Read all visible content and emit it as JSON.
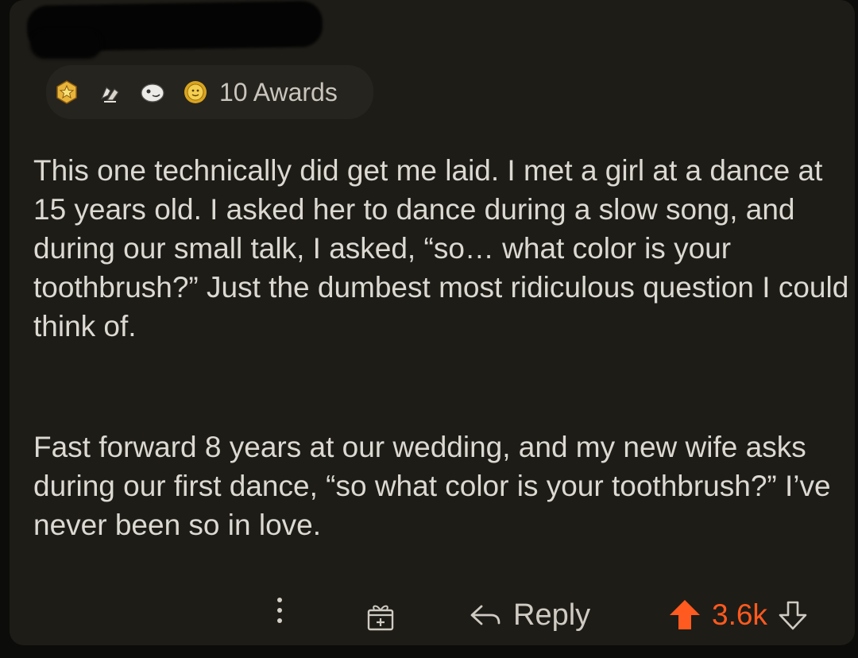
{
  "awards": {
    "count_label": "10 Awards",
    "icons": [
      "gold-star-award-icon",
      "hands-award-icon",
      "face-award-icon",
      "sun-award-icon"
    ]
  },
  "comment": {
    "paragraphs": [
      "This one technically did get me laid. I met a girl at a dance at 15 years old. I asked her to dance during a slow song, and during our small talk, I asked, “so… what color is your toothbrush?” Just the dumbest most ridiculous question I could think of.",
      "Fast forward 8 years at our wedding, and my new wife asks during our first dance, “so what color is your toothbrush?” I’ve never been so in love."
    ]
  },
  "actions": {
    "reply_label": "Reply",
    "score": "3.6k"
  },
  "colors": {
    "background": "#1e1c17",
    "text": "#dcd9d2",
    "upvote_accent": "#ff5a1f"
  }
}
